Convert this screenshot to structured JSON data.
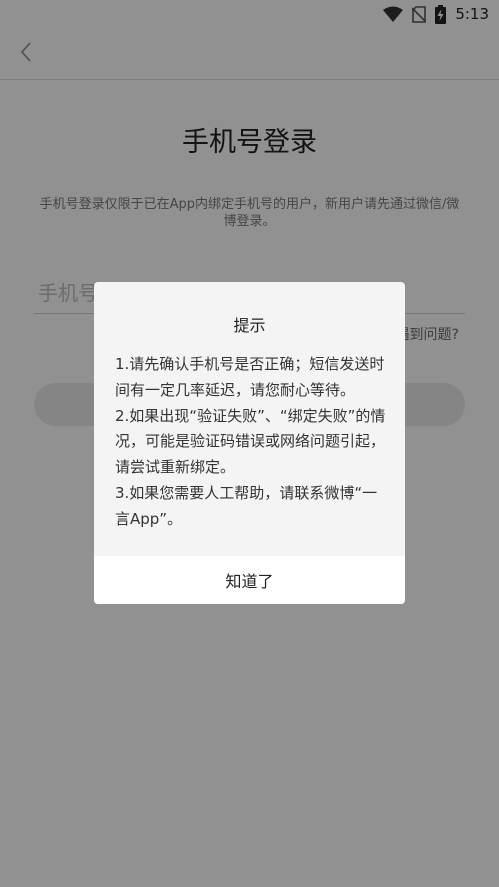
{
  "status_bar": {
    "time": "5:13",
    "icons": [
      "wifi-icon",
      "no-sim-icon",
      "battery-charging-icon"
    ]
  },
  "app_bar": {
    "back_icon": "chevron-left-icon"
  },
  "main": {
    "title": "手机号登录",
    "notice": "手机号登录仅限于已在App内绑定手机号的用户，新用户请先通过微信/微博登录。",
    "phone_placeholder": "手机号",
    "help_link": "遇到问题?",
    "login_button": ""
  },
  "dialog": {
    "title": "提示",
    "lines": [
      "1.请先确认手机号是否正确；短信发送时间有一定几率延迟，请您耐心等待。",
      "2.如果出现“验证失败”、“绑定失败”的情况，可能是验证码错误或网络问题引起，请尝试重新绑定。",
      "3.如果您需要人工帮助，请联系微博“一言App”。"
    ],
    "confirm_label": "知道了"
  },
  "colors": {
    "background": "#fafafa",
    "scrim": "rgba(0,0,0,0.42)",
    "dialog_bg": "#f4f4f4",
    "text_primary": "#222222"
  }
}
